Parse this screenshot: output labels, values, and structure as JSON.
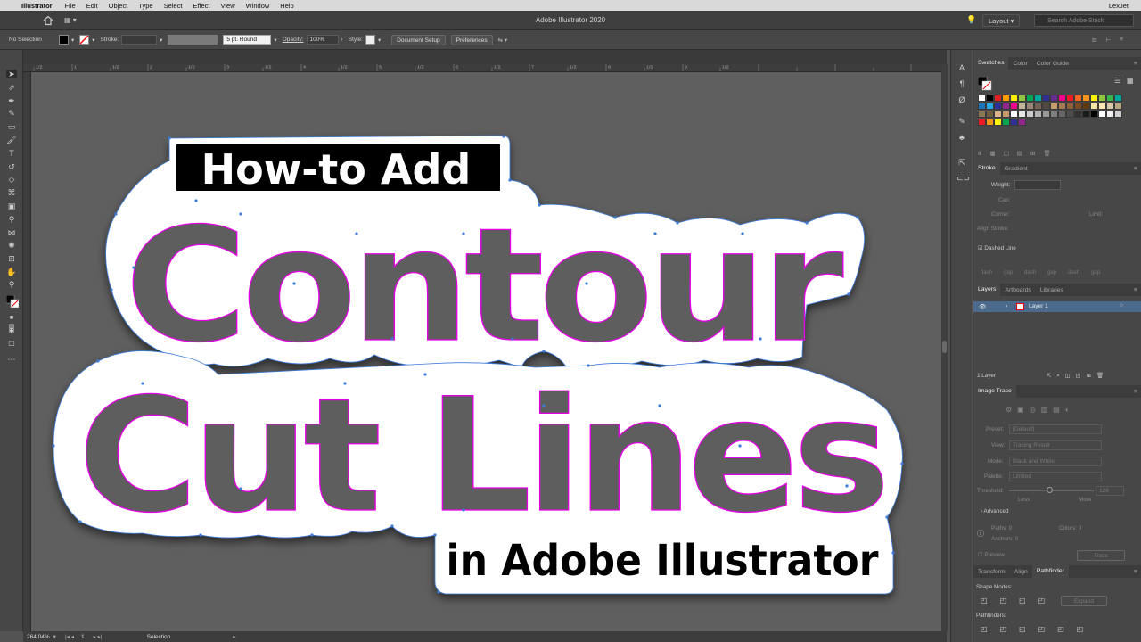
{
  "menubar": {
    "app_name": "Illustrator",
    "menus": [
      "File",
      "Edit",
      "Object",
      "Type",
      "Select",
      "Effect",
      "View",
      "Window",
      "Help"
    ],
    "right": "LexJet"
  },
  "appbar": {
    "title": "Adobe Illustrator 2020",
    "layout_label": "Layout",
    "stock_placeholder": "Search Adobe Stock"
  },
  "control": {
    "selection": "No Selection",
    "stroke_label": "Stroke:",
    "brush": "5 pt. Round",
    "opacity_label": "Opacity:",
    "opacity_value": "100%",
    "style_label": "Style:",
    "document_setup": "Document Setup",
    "preferences": "Preferences"
  },
  "artwork": {
    "line1": "How-to Add",
    "line2": "Contour",
    "line3": "Cut Lines",
    "line4": "in Adobe Illustrator"
  },
  "rulers": {
    "top_marks": [
      "1/2",
      "1",
      "1/2",
      "2",
      "1/2",
      "3",
      "1/2",
      "4",
      "1/2",
      "5",
      "1/2",
      "6",
      "1/2",
      "7",
      "1/2",
      "8",
      "1/2",
      "9",
      "1/2"
    ]
  },
  "status": {
    "zoom": "264.04%",
    "artboard": "1",
    "mode": "Selection"
  },
  "swatches": {
    "tabs": [
      "Swatches",
      "Color",
      "Color Guide"
    ],
    "rows": [
      [
        "#ffffff",
        "#000000",
        "#e02020",
        "#ff9900",
        "#ffee00",
        "#8ec63f",
        "#00a651",
        "#00a99d",
        "#2e3192",
        "#662d91",
        "#ec008c",
        "#ed1c24",
        "#f26522",
        "#f7941d",
        "#fff200",
        "#8dc63f",
        "#39b54a",
        "#00a99d"
      ],
      [
        "#1b75bc",
        "#27aae1",
        "#2e3192",
        "#92278f",
        "#ec008c",
        "#c2b59b",
        "#998675",
        "#736357",
        "#534741",
        "#c69c6d",
        "#a67c52",
        "#8c6239",
        "#754c24",
        "#603913",
        "#f5e6a8",
        "#ffe7b5",
        "#d7c8a8",
        "#b8a882"
      ],
      [
        "#8a7a5a",
        "#6b5e43",
        "#d9b38c",
        "#c49a6c",
        "#ffffff",
        "#e6e6e6",
        "#cccccc",
        "#b3b3b3",
        "#999999",
        "#808080",
        "#666666",
        "#4d4d4d",
        "#333333",
        "#1a1a1a",
        "#000000",
        "#ffffff",
        "#f0f0f0",
        "#d0d0d0"
      ],
      [
        "#ed1c24",
        "#f7941d",
        "#fff200",
        "#00a651",
        "#2e3192",
        "#92278f"
      ]
    ]
  },
  "stroke_panel": {
    "tabs": [
      "Stroke",
      "Gradient"
    ],
    "weight_label": "Weight:",
    "cap_label": "Cap:",
    "corner_label": "Corner:",
    "limit_label": "Limit:",
    "align_label": "Align Stroke:",
    "dashed_label": "Dashed Line",
    "dash_labels": [
      "dash",
      "gap",
      "dash",
      "gap",
      "dash",
      "gap"
    ]
  },
  "layers_panel": {
    "tabs": [
      "Layers",
      "Artboards",
      "Libraries"
    ],
    "layer_name": "Layer 1",
    "count": "1 Layer"
  },
  "image_trace": {
    "title": "Image Trace",
    "preset_label": "Preset:",
    "preset_value": "[Default]",
    "view_label": "View:",
    "view_value": "Tracing Result",
    "mode_label": "Mode:",
    "mode_value": "Black and White",
    "palette_label": "Palette:",
    "palette_value": "Limited",
    "threshold_label": "Threshold:",
    "threshold_value": "128",
    "less": "Less",
    "more": "More",
    "advanced": "Advanced",
    "paths_label": "Paths:",
    "paths_value": "0",
    "colors_label": "Colors:",
    "colors_value": "0",
    "anchors_label": "Anchors:",
    "anchors_value": "0",
    "preview": "Preview",
    "trace": "Trace"
  },
  "pathfinder_panel": {
    "tabs": [
      "Transform",
      "Align",
      "Pathfinder"
    ],
    "shape_modes": "Shape Modes:",
    "expand": "Expand",
    "pathfinders": "Pathfinders:"
  },
  "colors": {
    "accent": "#e8e8e8",
    "contour": "#e400e4",
    "anchor": "#3d7bd9",
    "letter_fill": "#5e5e5e",
    "label_box": "#000000"
  }
}
